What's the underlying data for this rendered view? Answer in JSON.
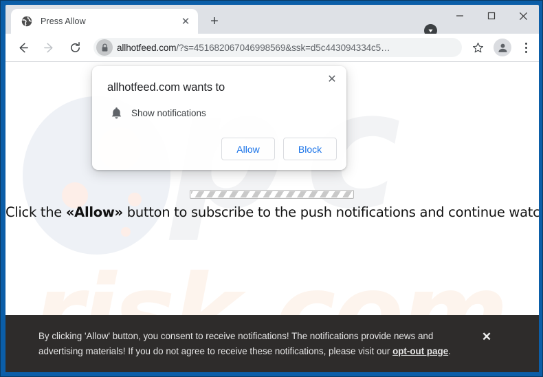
{
  "window": {
    "controls": {
      "download_icon": "download-chevron-icon",
      "minimize_label": "—",
      "maximize_label": "□",
      "close_label": "✕"
    }
  },
  "tabstrip": {
    "tabs": [
      {
        "favicon": "globe-icon",
        "title": "Press Allow",
        "close_label": "✕"
      }
    ],
    "new_tab_label": "+"
  },
  "toolbar": {
    "back_icon": "back-arrow-icon",
    "forward_icon": "forward-arrow-icon",
    "reload_icon": "reload-icon",
    "lock_icon": "padlock-icon",
    "url_host": "allhotfeed.com",
    "url_path": "/?s=451682067046998569&ssk=d5c443094334c5…",
    "url_full": "allhotfeed.com/?s=451682067046998569&ssk=d5c443094334c5…",
    "bookmark_icon": "star-icon",
    "profile_icon": "person-avatar-icon",
    "menu_icon": "three-dot-menu-icon"
  },
  "permission_dialog": {
    "title": "allhotfeed.com wants to",
    "close_label": "✕",
    "row_icon": "bell-icon",
    "row_label": "Show notifications",
    "allow_label": "Allow",
    "block_label": "Block",
    "accent_color": "#1a73e8"
  },
  "page": {
    "watermark_glyphs": "pc",
    "watermark_text": "risk.com",
    "progress_bar": "indeterminate-striped-progress",
    "cta_prefix": "Click the ",
    "cta_emphasis": "«Allow»",
    "cta_suffix": " button to subscribe to the push notifications and continue watching"
  },
  "consent_banner": {
    "text_before_link": "By clicking 'Allow' button, you consent to receive notifications! The notifications provide news and advertising materials! If you do not agree to receive these notifications, please visit our ",
    "link_label": "opt-out page",
    "text_after_link": ".",
    "close_label": "✕",
    "background_color": "#2e2c2b"
  }
}
